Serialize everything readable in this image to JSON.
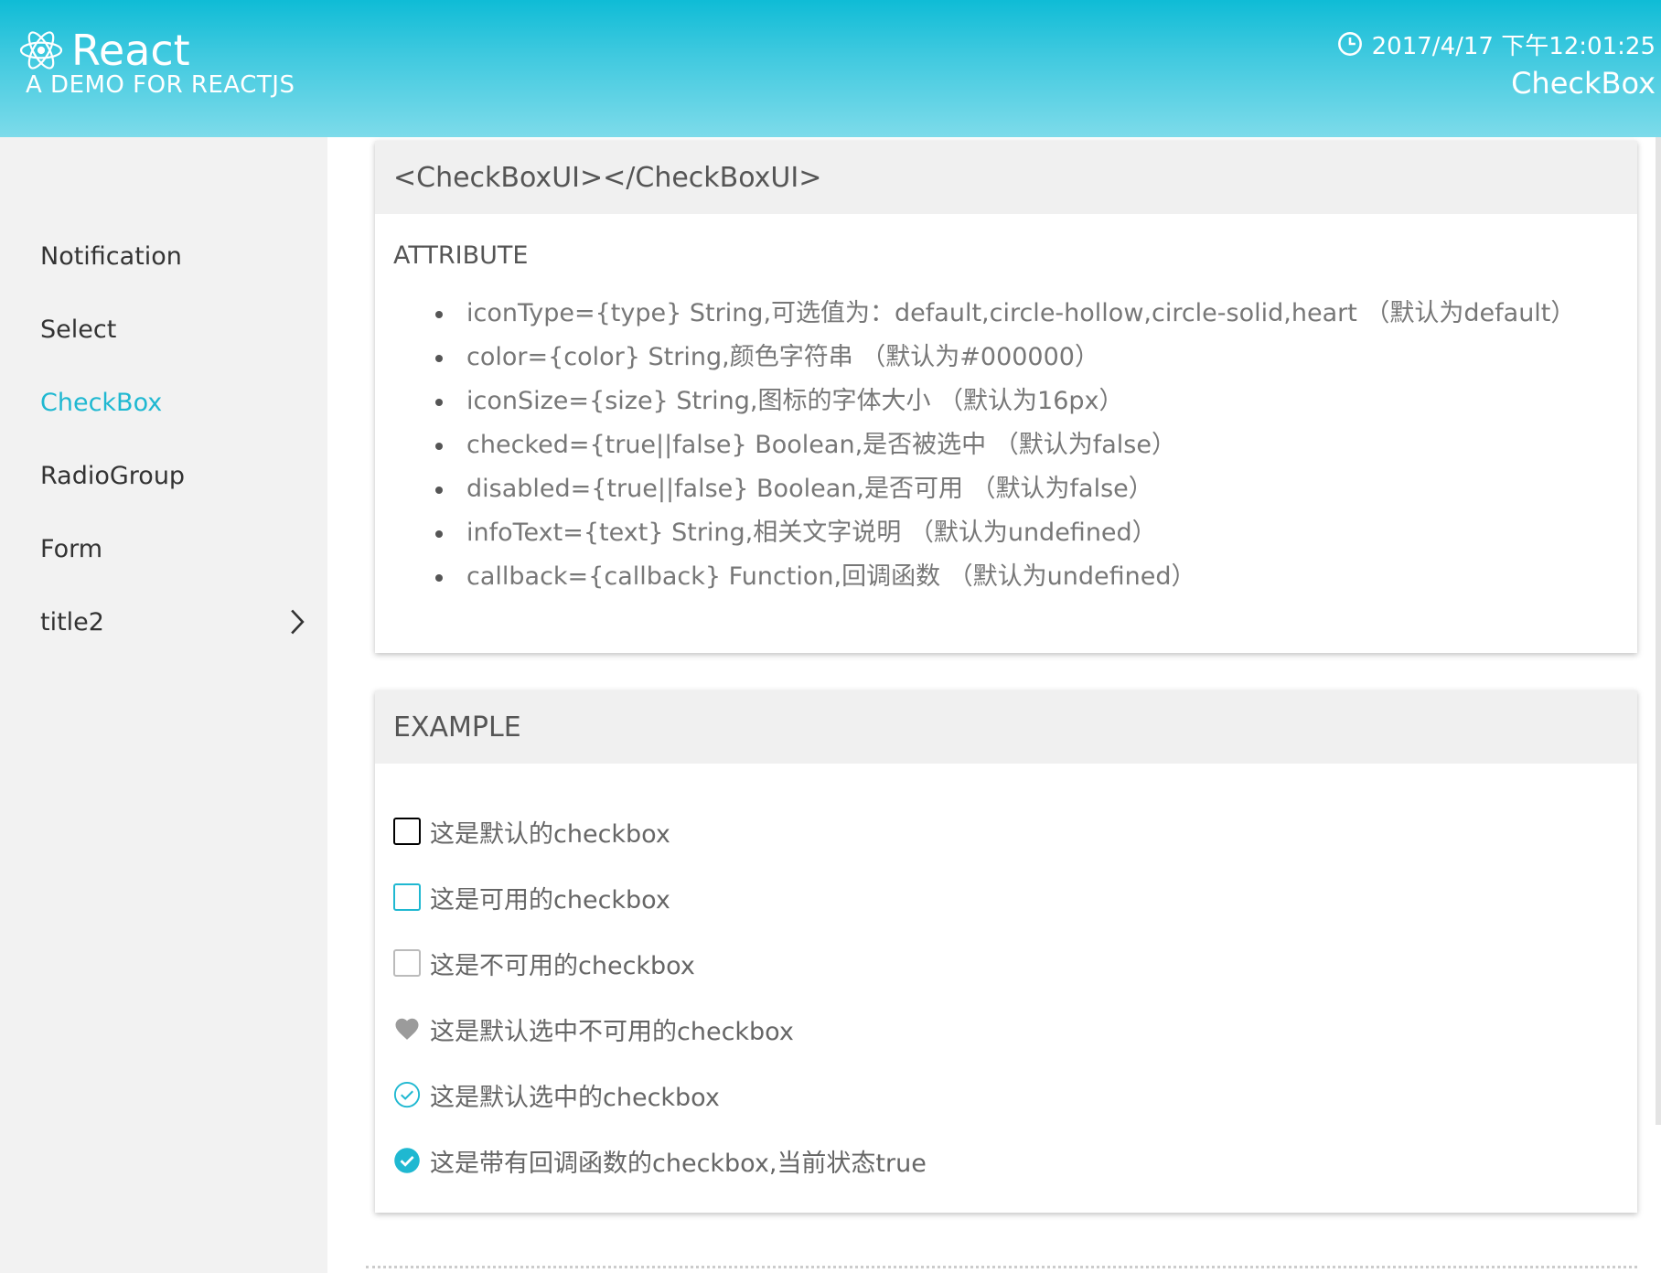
{
  "header": {
    "brand_title": "React",
    "brand_subtitle": "A DEMO FOR REACTJS",
    "datetime": "2017/4/17 下午12:01:25",
    "page_name": "CheckBox",
    "bg_color": "#0fbcd6"
  },
  "sidebar": {
    "items": [
      {
        "label": "Notification"
      },
      {
        "label": "Select"
      },
      {
        "label": "CheckBox",
        "active": true
      },
      {
        "label": "RadioGroup"
      },
      {
        "label": "Form"
      },
      {
        "label": "title2",
        "has_submenu": true
      }
    ],
    "active_color": "#1fb8d1"
  },
  "attribute_card": {
    "title": "<CheckBoxUI></CheckBoxUI>",
    "section_label": "ATTRIBUTE",
    "attributes": [
      "iconType={type} String,可选值为：default,circle-hollow,circle-solid,heart （默认为default）",
      "color={color} String,颜色字符串 （默认为#000000）",
      "iconSize={size} String,图标的字体大小 （默认为16px）",
      "checked={true||false} Boolean,是否被选中 （默认为false）",
      "disabled={true||false} Boolean,是否可用 （默认为false）",
      "infoText={text} String,相关文字说明 （默认为undefined）",
      "callback={callback} Function,回调函数 （默认为undefined）"
    ]
  },
  "example_card": {
    "title": "EXAMPLE",
    "examples": [
      {
        "label": "这是默认的checkbox",
        "icon": "square-empty-icon"
      },
      {
        "label": "这是可用的checkbox",
        "icon": "square-empty-cyan-icon"
      },
      {
        "label": "这是不可用的checkbox",
        "icon": "square-empty-disabled-icon"
      },
      {
        "label": "这是默认选中不可用的checkbox",
        "icon": "heart-icon"
      },
      {
        "label": "这是默认选中的checkbox",
        "icon": "circle-hollow-check-icon"
      },
      {
        "label": "这是带有回调函数的checkbox,当前状态true",
        "icon": "circle-solid-check-icon"
      }
    ]
  }
}
